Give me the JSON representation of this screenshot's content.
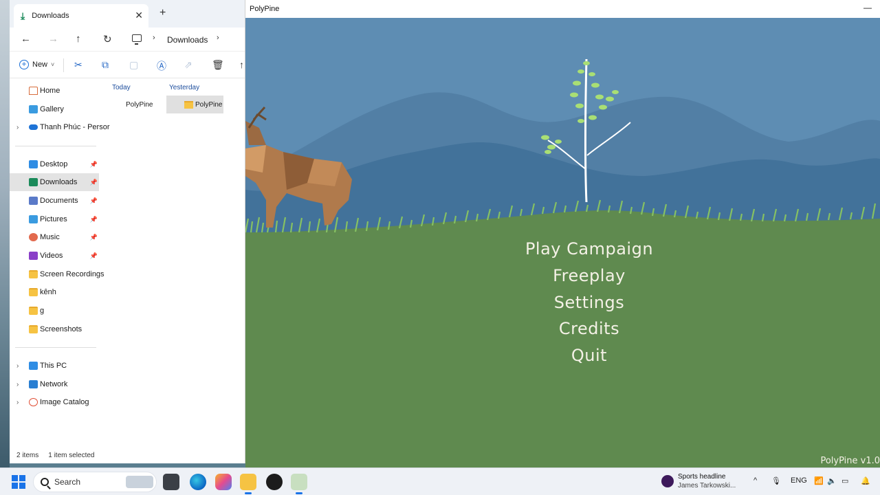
{
  "explorer": {
    "tab_title": "Downloads",
    "tab_close": "✕",
    "new_tab": "+",
    "nav_back": "←",
    "nav_forward": "→",
    "nav_up": "↑",
    "nav_refresh": "↻",
    "crumb_sep": "›",
    "breadcrumb": "Downloads",
    "new_label": "New",
    "new_chevron": "˅",
    "sidebar": [
      {
        "label": "Home",
        "icon": "home-icon",
        "pinned": false
      },
      {
        "label": "Gallery",
        "icon": "gallery-icon",
        "pinned": false
      },
      {
        "label": "Thanh Phúc - Persor",
        "icon": "onedrive-icon",
        "pinned": false,
        "expandable": true
      },
      {
        "label": "Desktop",
        "icon": "desktop-icon",
        "pinned": true
      },
      {
        "label": "Downloads",
        "icon": "downloads-icon",
        "pinned": true,
        "selected": true
      },
      {
        "label": "Documents",
        "icon": "documents-icon",
        "pinned": true
      },
      {
        "label": "Pictures",
        "icon": "pictures-icon",
        "pinned": true
      },
      {
        "label": "Music",
        "icon": "music-icon",
        "pinned": true
      },
      {
        "label": "Videos",
        "icon": "videos-icon",
        "pinned": true
      },
      {
        "label": "Screen Recordings",
        "icon": "folder-icon",
        "pinned": false
      },
      {
        "label": "kênh",
        "icon": "folder-icon",
        "pinned": false
      },
      {
        "label": "g",
        "icon": "folder-icon",
        "pinned": false
      },
      {
        "label": "Screenshots",
        "icon": "folder-icon",
        "pinned": false
      },
      {
        "label": "This PC",
        "icon": "this-pc-icon",
        "pinned": false,
        "expandable": true
      },
      {
        "label": "Network",
        "icon": "network-icon",
        "pinned": false,
        "expandable": true
      },
      {
        "label": "Image Catalog",
        "icon": "image-catalog-icon",
        "pinned": false,
        "expandable": true
      }
    ],
    "groups": [
      {
        "header": "Today",
        "files": [
          {
            "name": "PolyPine",
            "icon": "game-file-icon",
            "selected": false
          }
        ]
      },
      {
        "header": "Yesterday",
        "files": [
          {
            "name": "PolyPine",
            "icon": "folder-icon",
            "selected": true
          }
        ]
      }
    ],
    "status_items": "2 items",
    "status_selected": "1 item selected"
  },
  "game": {
    "window_title": "PolyPine",
    "minimize": "—",
    "menu": [
      "Play Campaign",
      "Freeplay",
      "Settings",
      "Credits",
      "Quit"
    ],
    "version": "PolyPine v1.0",
    "colors": {
      "sky": "#5e8db3",
      "mountain_far": "#4e7ea6",
      "mountain_near": "#3f6e96",
      "grass_field": "#5f8a4f",
      "grass_blades": "#7fb95c",
      "menu_text": "#f4f1e6"
    }
  },
  "taskbar": {
    "search_label": "Search",
    "news_title": "Sports headline",
    "news_sub": "James Tarkowski...",
    "language": "ENG",
    "chevron_up": "^"
  }
}
